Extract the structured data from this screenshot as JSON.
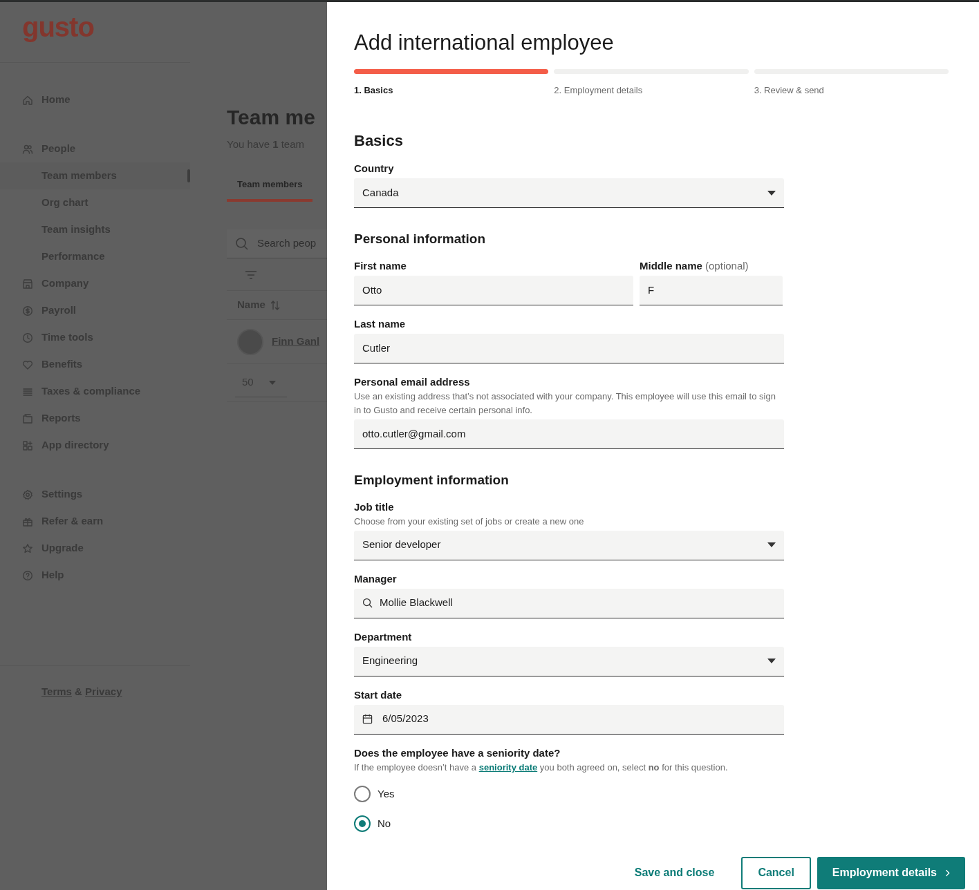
{
  "app": {
    "logo": "gusto",
    "sidebar": {
      "groups": [
        {
          "items": [
            {
              "label": "Home",
              "selected": false
            }
          ]
        },
        {
          "items": [
            {
              "label": "People",
              "selected": false,
              "children": [
                {
                  "label": "Team members",
                  "selected": true
                },
                {
                  "label": "Org chart",
                  "selected": false
                },
                {
                  "label": "Team insights",
                  "selected": false
                },
                {
                  "label": "Performance",
                  "selected": false
                }
              ]
            },
            {
              "label": "Company",
              "selected": false
            },
            {
              "label": "Payroll",
              "selected": false
            },
            {
              "label": "Time tools",
              "selected": false
            },
            {
              "label": "Benefits",
              "selected": false
            },
            {
              "label": "Taxes & compliance",
              "selected": false
            },
            {
              "label": "Reports",
              "selected": false
            },
            {
              "label": "App directory",
              "selected": false
            }
          ]
        },
        {
          "items": [
            {
              "label": "Settings",
              "selected": false
            },
            {
              "label": "Refer & earn",
              "selected": false
            },
            {
              "label": "Upgrade",
              "selected": false
            },
            {
              "label": "Help",
              "selected": false
            }
          ]
        }
      ],
      "footer": {
        "terms": "Terms",
        "joiner": "&",
        "privacy": "Privacy"
      }
    },
    "page": {
      "title": "Team me",
      "subtitle": "You have **1** team",
      "tabs": [
        {
          "label": "Team members",
          "selected": true
        }
      ],
      "search": {
        "placeholder": "Search peop"
      },
      "table": {
        "columns": [
          "Name"
        ],
        "rows": [
          {
            "name": "Finn Ganl"
          }
        ]
      },
      "page_size": "50"
    }
  },
  "dialog": {
    "title": "Add international employee",
    "steps": [
      {
        "label": "1. Basics",
        "selected": true
      },
      {
        "label": "2. Employment details",
        "selected": false
      },
      {
        "label": "3. Review & send",
        "selected": false
      }
    ],
    "sections": [
      {
        "heading": "Basics",
        "fields": [
          {
            "kind": "select",
            "label": "Country",
            "value": "Canada"
          }
        ]
      },
      {
        "heading": "Personal information",
        "fields": [
          {
            "kind": "pair",
            "fields": [
              {
                "kind": "text",
                "label": "First name",
                "value": "Otto"
              },
              {
                "kind": "text",
                "label": "Middle name",
                "hint": "(optional)",
                "value": "F"
              }
            ]
          },
          {
            "kind": "text",
            "label": "Last name",
            "value": "Cutler"
          },
          {
            "kind": "text",
            "label": "Personal email address",
            "help": "Use an existing address that’s not associated with your company. This employee will use this email to sign in to Gusto and receive certain personal info.",
            "value": "otto.cutler@gmail.com"
          }
        ]
      },
      {
        "heading": "Employment information",
        "fields": [
          {
            "kind": "select",
            "label": "Job title",
            "help": "Choose from your existing set of jobs or create a new one",
            "value": "Senior developer"
          },
          {
            "kind": "search",
            "label": "Manager",
            "value": "Mollie Blackwell"
          },
          {
            "kind": "select",
            "label": "Department",
            "value": "Engineering"
          },
          {
            "kind": "date",
            "label": "Start date",
            "value": "6/05/2023"
          },
          {
            "kind": "radio",
            "label": "Does the employee have a seniority date?",
            "help_parts": {
              "before": "If the employee doesn’t have a",
              "link": "seniority date",
              "after": "you both agreed on, select **no** for this question."
            },
            "options": [
              {
                "label": "Yes",
                "selected": false
              },
              {
                "label": "No",
                "selected": true
              }
            ]
          }
        ]
      }
    ],
    "actions": [
      {
        "kind": "link",
        "label": "Save and close"
      },
      {
        "kind": "outline",
        "label": "Cancel"
      },
      {
        "kind": "primary",
        "label": "Employment details"
      }
    ]
  }
}
